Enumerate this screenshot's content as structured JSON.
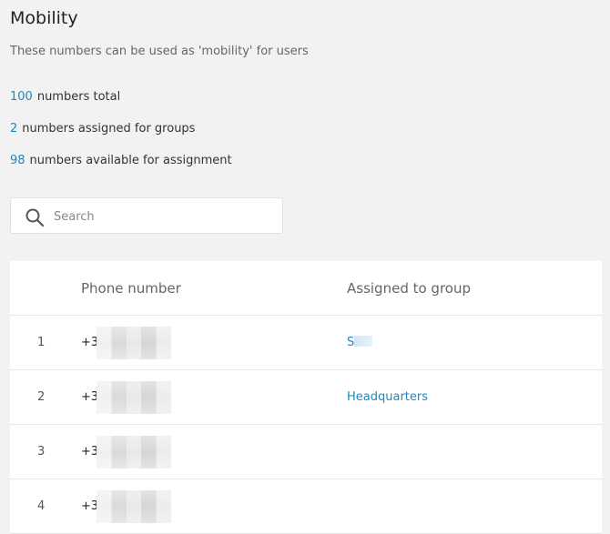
{
  "page": {
    "title": "Mobility",
    "subtitle": "These numbers can be used as 'mobility' for users"
  },
  "stats": [
    {
      "value": "100",
      "label": "numbers total"
    },
    {
      "value": "2",
      "label": "numbers assigned for groups"
    },
    {
      "value": "98",
      "label": "numbers available for assignment"
    }
  ],
  "search": {
    "placeholder": "Search",
    "icon": "search-icon"
  },
  "table": {
    "columns": {
      "phone": "Phone number",
      "group": "Assigned to group"
    },
    "rows": [
      {
        "index": "1",
        "phone_prefix": "+3",
        "group": "S"
      },
      {
        "index": "2",
        "phone_prefix": "+3",
        "group": "Headquarters"
      },
      {
        "index": "3",
        "phone_prefix": "+3",
        "group": ""
      },
      {
        "index": "4",
        "phone_prefix": "+3",
        "group": ""
      }
    ]
  },
  "colors": {
    "accent": "#1a8ac6",
    "background": "#f2f2f2"
  }
}
